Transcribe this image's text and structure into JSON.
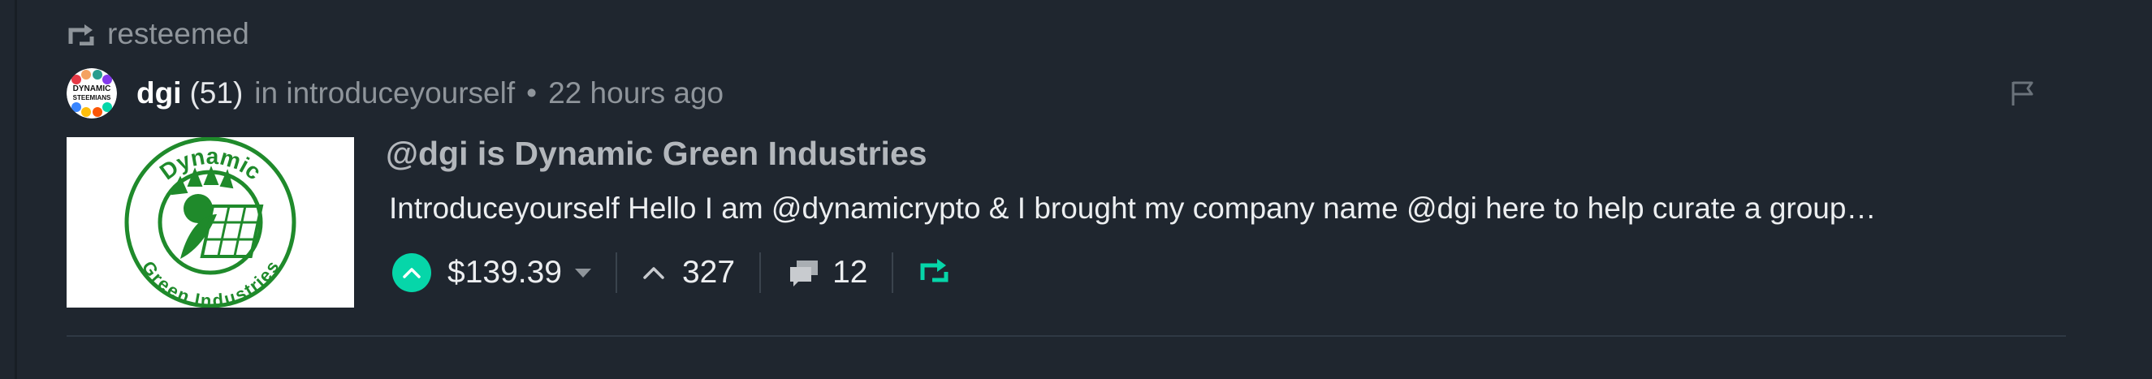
{
  "resteem": {
    "icon": "resteem-icon",
    "label": "resteemed"
  },
  "post": {
    "author": "dgi",
    "reputation": "(51)",
    "community_prefix": "in introduceyourself",
    "separator": "•",
    "timestamp": "22 hours ago",
    "avatar_text_line1": "DYNAMIC",
    "avatar_text_line2": "STEEMIANS",
    "thumbnail_text_top": "Dynamic",
    "thumbnail_text_bottom": "Green Industries",
    "title": "@dgi is Dynamic Green Industries",
    "body_preview": "Introduceyourself Hello I am @dynamicrypto & I brought my company name @dgi here to help curate a group…",
    "payout": "$139.39",
    "votes": "327",
    "comments": "12"
  },
  "colors": {
    "background": "#1f262f",
    "accent": "#06d6a9",
    "muted": "#8f959b",
    "thumbnail_green": "#1f8a2b"
  },
  "icons": {
    "resteem": "resteem-icon",
    "flag": "flag-icon",
    "upvote": "upvote-icon",
    "payout_dropdown": "chevron-down-icon",
    "votes": "chevron-up-icon",
    "comments": "comments-icon",
    "reblog": "reblog-icon"
  }
}
